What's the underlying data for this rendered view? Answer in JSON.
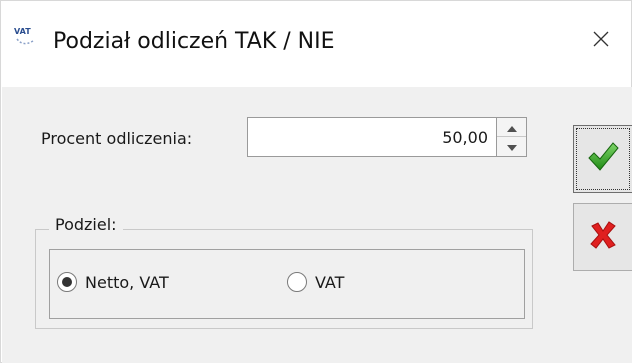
{
  "window": {
    "title": "Podział odliczeń TAK / NIE",
    "icon_text": "VAT",
    "icon": "vat-icon",
    "close_icon": "close-icon"
  },
  "form": {
    "percent_label": "Procent odliczenia:",
    "percent_value": "50,00",
    "group_label": "Podziel:",
    "options": [
      {
        "label": "Netto, VAT",
        "selected": true
      },
      {
        "label": "VAT",
        "selected": false
      }
    ]
  },
  "buttons": {
    "ok_icon": "checkmark-icon",
    "cancel_icon": "cross-icon"
  },
  "colors": {
    "ok_green": "#2e9e1f",
    "cancel_red": "#e02020",
    "client_bg": "#f0f0f0"
  }
}
